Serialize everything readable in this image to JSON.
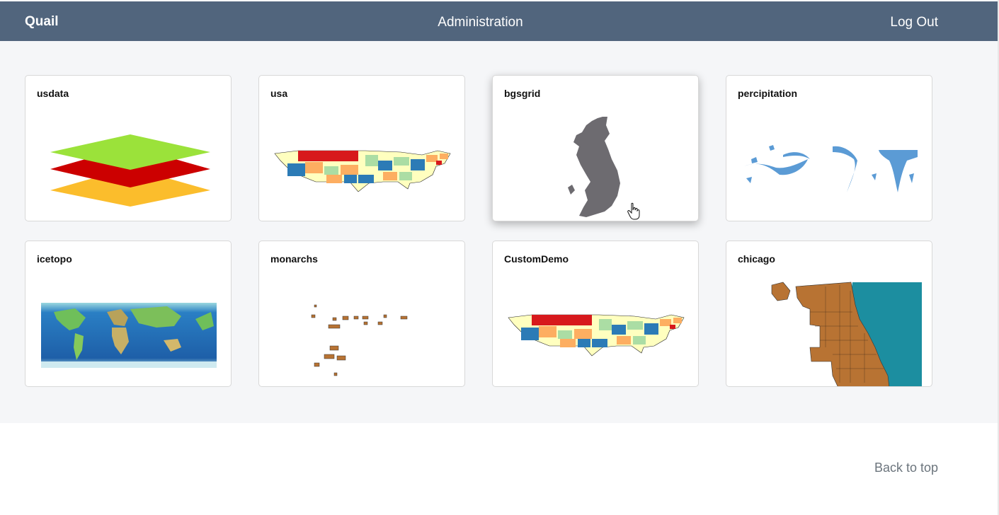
{
  "nav": {
    "brand": "Quail",
    "center_link": "Administration",
    "right_link": "Log Out"
  },
  "cards": [
    {
      "title": "usdata"
    },
    {
      "title": "usa"
    },
    {
      "title": "bgsgrid"
    },
    {
      "title": "percipitation"
    },
    {
      "title": "icetopo"
    },
    {
      "title": "monarchs"
    },
    {
      "title": "CustomDemo"
    },
    {
      "title": "chicago"
    }
  ],
  "colors": {
    "navbar": "#51657d",
    "background": "#f5f6f8"
  },
  "footer": {
    "back_to_top": "Back to top"
  }
}
